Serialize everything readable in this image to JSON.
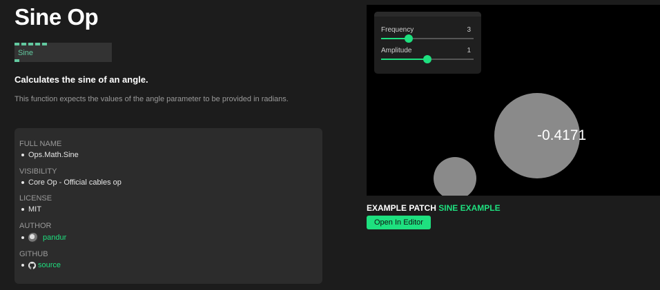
{
  "page": {
    "title": "Sine Op"
  },
  "op_node": {
    "label": "Sine",
    "input_port_count": 5
  },
  "summary": "Calculates the sine of an angle.",
  "description": "This function expects the values of the angle parameter to be provided in radians.",
  "info": {
    "full_name": {
      "heading": "FULL NAME",
      "value": "Ops.Math.Sine"
    },
    "visibility": {
      "heading": "VISIBILITY",
      "value": "Core Op - Official cables op"
    },
    "license": {
      "heading": "LICENSE",
      "value": "MIT"
    },
    "author": {
      "heading": "AUTHOR",
      "value": "pandur",
      "icon": "avatar"
    },
    "github": {
      "heading": "GITHUB",
      "value": "source",
      "icon": "github-icon"
    }
  },
  "preview": {
    "sliders": [
      {
        "label": "Frequency",
        "value": "3",
        "fill_fraction": 0.3
      },
      {
        "label": "Amplitude",
        "value": "1",
        "fill_fraction": 0.5
      }
    ],
    "output_value": "-0.4171"
  },
  "example": {
    "prefix": "EXAMPLE PATCH",
    "name": "SINE EXAMPLE",
    "button_label": "Open In Editor"
  },
  "colors": {
    "accent": "#1ee07f",
    "port": "#63c9a0",
    "background": "#1c1c1c",
    "panel": "#2c2c2c",
    "canvas": "#000000",
    "circle": "#8a8a8a"
  }
}
